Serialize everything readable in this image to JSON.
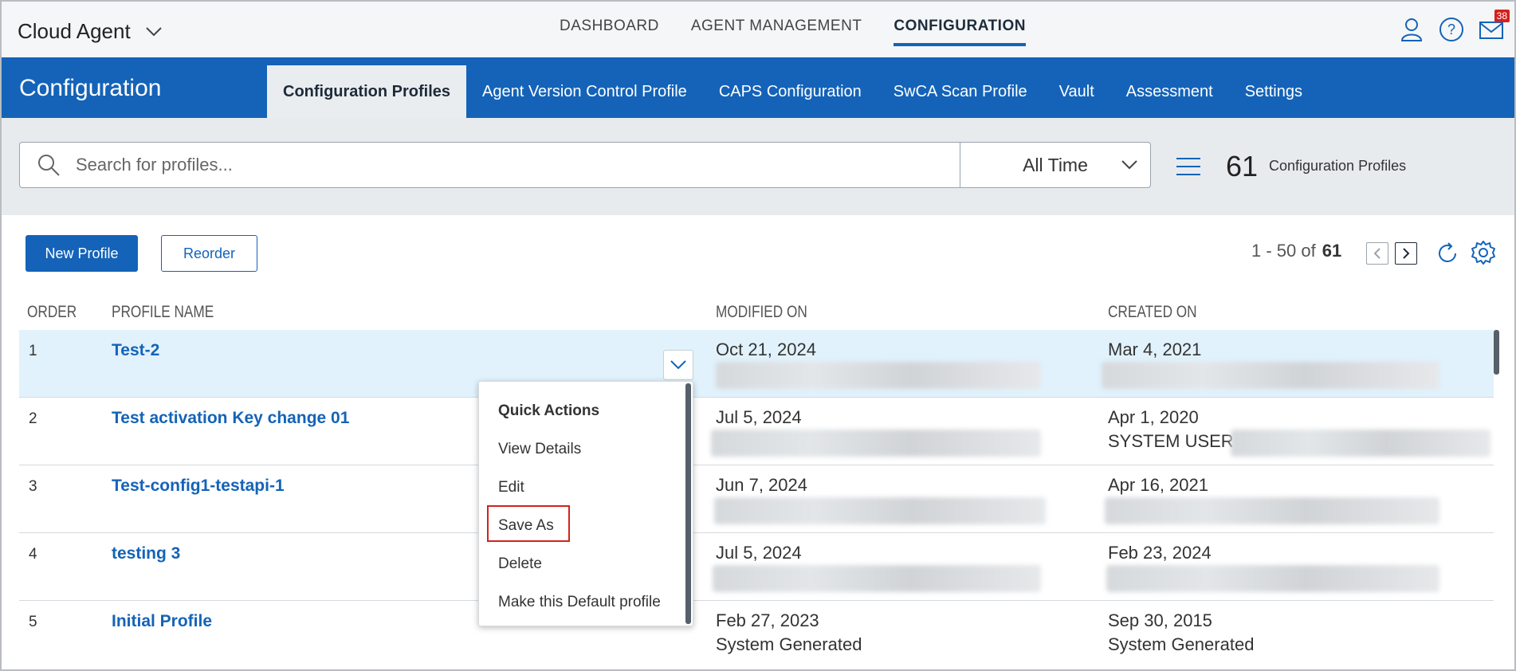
{
  "app": {
    "title": "Cloud Agent"
  },
  "topnav": [
    {
      "label": "DASHBOARD",
      "active": false
    },
    {
      "label": "AGENT MANAGEMENT",
      "active": false
    },
    {
      "label": "CONFIGURATION",
      "active": true
    }
  ],
  "header_icons": {
    "user": "user-icon",
    "help": "help-icon",
    "mail": "mail-icon",
    "mail_badge": "38"
  },
  "section": {
    "title": "Configuration"
  },
  "subtabs": [
    {
      "label": "Configuration Profiles",
      "active": true
    },
    {
      "label": "Agent Version Control Profile",
      "active": false
    },
    {
      "label": "CAPS Configuration",
      "active": false
    },
    {
      "label": "SwCA Scan Profile",
      "active": false
    },
    {
      "label": "Vault",
      "active": false
    },
    {
      "label": "Assessment",
      "active": false
    },
    {
      "label": "Settings",
      "active": false
    }
  ],
  "search": {
    "placeholder": "Search for profiles...",
    "value": ""
  },
  "time_filter": {
    "selected": "All Time"
  },
  "summary": {
    "count": "61",
    "label": "Configuration Profiles"
  },
  "actions": {
    "new_profile": "New Profile",
    "reorder": "Reorder"
  },
  "pagination": {
    "range": "1 - 50 of",
    "total": "61"
  },
  "table": {
    "columns": {
      "order": "ORDER",
      "name": "PROFILE NAME",
      "modified": "MODIFIED ON",
      "created": "CREATED ON"
    },
    "rows": [
      {
        "order": "1",
        "name": "Test-2",
        "modified": "Oct 21, 2024",
        "modified_by": "",
        "created": "Mar 4, 2021",
        "created_by": ""
      },
      {
        "order": "2",
        "name": "Test activation Key change 01",
        "modified": "Jul 5, 2024",
        "modified_by": "",
        "created": "Apr 1, 2020",
        "created_by": "SYSTEM USER"
      },
      {
        "order": "3",
        "name": "Test-config1-testapi-1",
        "modified": "Jun 7, 2024",
        "modified_by": "",
        "created": "Apr 16, 2021",
        "created_by": ""
      },
      {
        "order": "4",
        "name": "testing 3",
        "modified": "Jul 5, 2024",
        "modified_by": "",
        "created": "Feb 23, 2024",
        "created_by": ""
      },
      {
        "order": "5",
        "name": "Initial Profile",
        "modified": "Feb 27, 2023",
        "modified_by": "System Generated",
        "created": "Sep 30, 2015",
        "created_by": "System Generated"
      }
    ]
  },
  "quick_actions": {
    "title": "Quick Actions",
    "items": [
      "View Details",
      "Edit",
      "Save As",
      "Delete",
      "Make this Default profile"
    ],
    "highlighted": "Save As"
  },
  "colors": {
    "brand": "#1463b8",
    "selected_row": "#e1f2fc",
    "highlight": "#d4211d"
  }
}
